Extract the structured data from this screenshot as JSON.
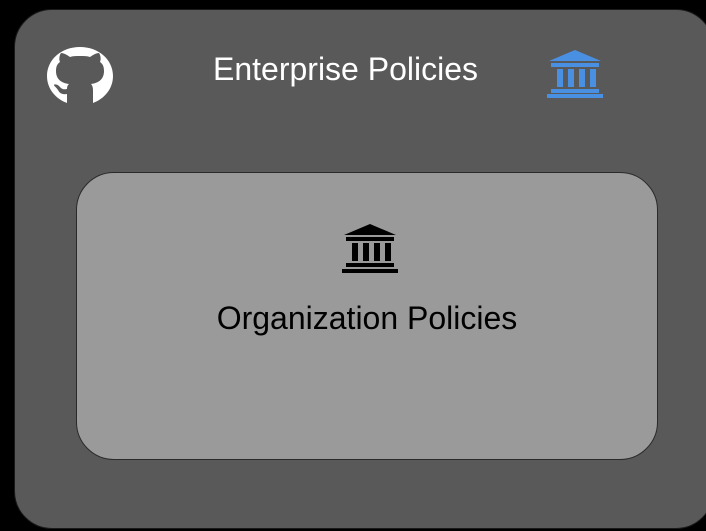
{
  "enterprise": {
    "title": "Enterprise Policies",
    "icon": "bank-building-icon",
    "icon_color": "#4a90e2",
    "box_color": "#595959"
  },
  "organization": {
    "title": "Organization Policies",
    "icon": "bank-building-icon",
    "icon_color": "#000000",
    "box_color": "#9a9a9a"
  },
  "logo": {
    "icon": "github-icon",
    "color": "#ffffff"
  }
}
